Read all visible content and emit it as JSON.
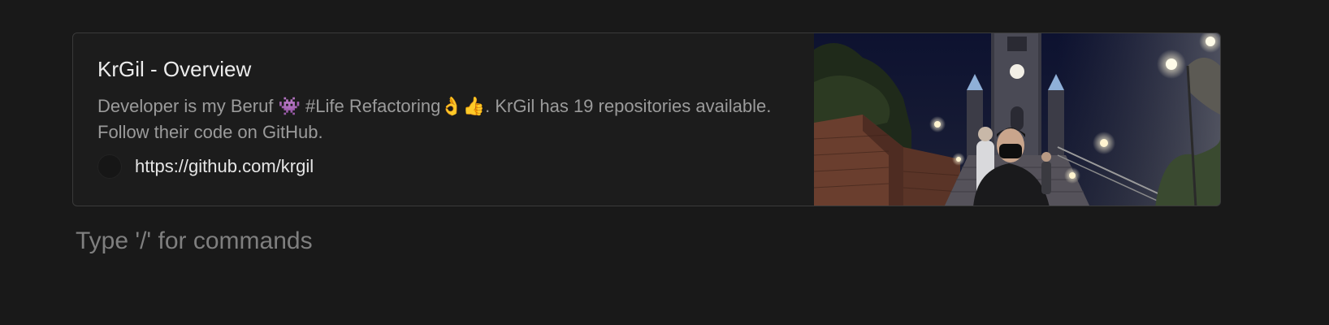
{
  "bookmark": {
    "title": "KrGil - Overview",
    "description": "Developer is my Beruf 👾 #Life Refactoring👌👍. KrGil has 19 repositories available. Follow their code on GitHub.",
    "url": "https://github.com/krgil",
    "preview_icon": "photo-preview",
    "favicon_icon": "github-favicon-icon"
  },
  "editor": {
    "placeholder": "Type '/' for commands"
  },
  "colors": {
    "background": "#191919",
    "card_border": "#3a3a3a",
    "muted_text": "#9b9b9b",
    "placeholder_text": "#7f7f7f"
  }
}
